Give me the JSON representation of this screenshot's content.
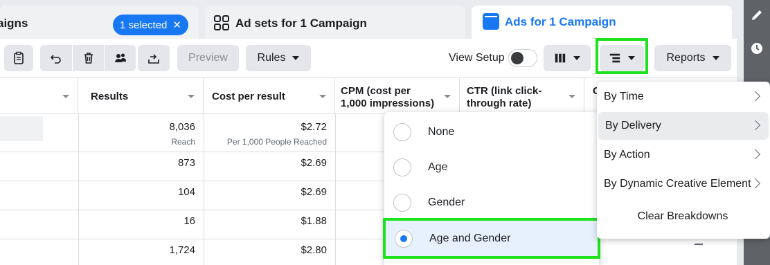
{
  "tabs": {
    "campaigns": {
      "label": "aigns",
      "selected_pill": "1 selected",
      "close": "✕"
    },
    "adsets": {
      "label": "Ad sets for 1 Campaign"
    },
    "ads": {
      "label": "Ads for 1 Campaign"
    }
  },
  "toolbar": {
    "preview_label": "Preview",
    "rules_label": "Rules",
    "view_setup_label": "View Setup",
    "reports_label": "Reports"
  },
  "table": {
    "headers": {
      "results": "Results",
      "cost_per_result": "Cost per result",
      "cpm_line1": "CPM (cost per",
      "cpm_line2": "1,000 impressions)",
      "ctr_line1": "CTR (link click-",
      "ctr_line2": "through rate)",
      "next_partial": "C"
    },
    "rows": [
      {
        "results": "8,036",
        "results_sub": "Reach",
        "cost": "$2.72",
        "cost_sub": "Per 1,000 People Reached"
      },
      {
        "results": "873",
        "cost": "$2.69"
      },
      {
        "results": "104",
        "cost": "$2.69"
      },
      {
        "results": "16",
        "cost": "$1.88"
      },
      {
        "results": "1,724",
        "cost": "$2.80"
      }
    ]
  },
  "breakdown_options": {
    "none": "None",
    "age": "Age",
    "gender": "Gender",
    "age_and_gender": "Age and Gender",
    "selected": "Age and Gender"
  },
  "breakdown_menu": {
    "by_time": "By Time",
    "by_delivery": "By Delivery",
    "by_action": "By Action",
    "by_dynamic": "By Dynamic Creative Element",
    "clear": "Clear Breakdowns"
  },
  "colors": {
    "accent": "#1877f2",
    "highlight": "#1ee21e"
  }
}
